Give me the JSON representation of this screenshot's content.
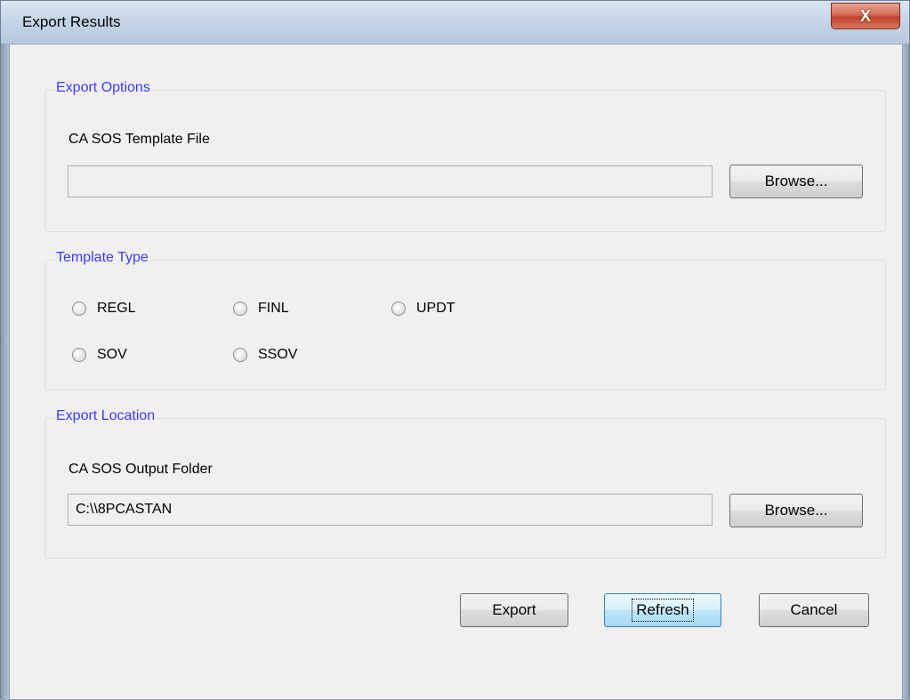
{
  "window": {
    "title": "Export Results",
    "close_label": "X"
  },
  "export_options": {
    "legend": "Export Options",
    "template_label": "CA SOS Template File",
    "template_value": "",
    "browse_label": "Browse..."
  },
  "template_type": {
    "legend": "Template Type",
    "options": [
      "REGL",
      "FINL",
      "UPDT",
      "SOV",
      "SSOV"
    ],
    "selected": null
  },
  "export_location": {
    "legend": "Export Location",
    "folder_label": "CA SOS Output Folder",
    "folder_value": "C:\\\\8PCASTAN",
    "browse_label": "Browse..."
  },
  "actions": {
    "export_label": "Export",
    "refresh_label": "Refresh",
    "cancel_label": "Cancel"
  },
  "colors": {
    "legend_text": "#3a3aff",
    "default_button": "#3c7fb1"
  }
}
